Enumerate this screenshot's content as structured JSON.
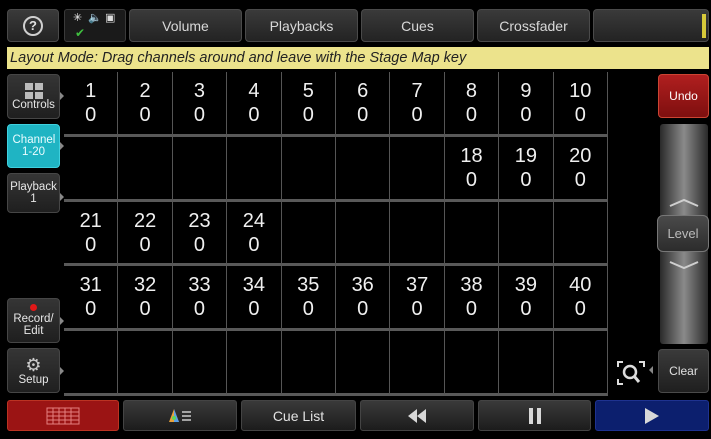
{
  "toolbar": {
    "help_icon": "?",
    "status_icons": [
      "sun-icon",
      "speaker-icon",
      "image-icon",
      "check-icon"
    ],
    "buttons": [
      "Volume",
      "Playbacks",
      "Cues",
      "Crossfader"
    ]
  },
  "banner": "Layout Mode: Drag channels around and leave with the Stage Map key",
  "sidebar": {
    "controls": "Controls",
    "channel": "Channel 1-20",
    "playback": "Playback 1",
    "record_edit": "Record/ Edit",
    "setup": "Setup"
  },
  "grid": {
    "rows": [
      [
        {
          "num": "1",
          "val": "0"
        },
        {
          "num": "2",
          "val": "0"
        },
        {
          "num": "3",
          "val": "0"
        },
        {
          "num": "4",
          "val": "0"
        },
        {
          "num": "5",
          "val": "0"
        },
        {
          "num": "6",
          "val": "0"
        },
        {
          "num": "7",
          "val": "0"
        },
        {
          "num": "8",
          "val": "0"
        },
        {
          "num": "9",
          "val": "0"
        },
        {
          "num": "10",
          "val": "0"
        }
      ],
      [
        {
          "num": "",
          "val": ""
        },
        {
          "num": "",
          "val": ""
        },
        {
          "num": "",
          "val": ""
        },
        {
          "num": "",
          "val": ""
        },
        {
          "num": "",
          "val": ""
        },
        {
          "num": "",
          "val": ""
        },
        {
          "num": "",
          "val": ""
        },
        {
          "num": "18",
          "val": "0"
        },
        {
          "num": "19",
          "val": "0"
        },
        {
          "num": "20",
          "val": "0"
        }
      ],
      [
        {
          "num": "21",
          "val": "0"
        },
        {
          "num": "22",
          "val": "0"
        },
        {
          "num": "23",
          "val": "0"
        },
        {
          "num": "24",
          "val": "0"
        },
        {
          "num": "",
          "val": ""
        },
        {
          "num": "",
          "val": ""
        },
        {
          "num": "",
          "val": ""
        },
        {
          "num": "",
          "val": ""
        },
        {
          "num": "",
          "val": ""
        },
        {
          "num": "",
          "val": ""
        }
      ],
      [
        {
          "num": "31",
          "val": "0"
        },
        {
          "num": "32",
          "val": "0"
        },
        {
          "num": "33",
          "val": "0"
        },
        {
          "num": "34",
          "val": "0"
        },
        {
          "num": "35",
          "val": "0"
        },
        {
          "num": "36",
          "val": "0"
        },
        {
          "num": "37",
          "val": "0"
        },
        {
          "num": "38",
          "val": "0"
        },
        {
          "num": "39",
          "val": "0"
        },
        {
          "num": "40",
          "val": "0"
        }
      ],
      [
        {
          "num": "",
          "val": ""
        },
        {
          "num": "",
          "val": ""
        },
        {
          "num": "",
          "val": ""
        },
        {
          "num": "",
          "val": ""
        },
        {
          "num": "",
          "val": ""
        },
        {
          "num": "",
          "val": ""
        },
        {
          "num": "",
          "val": ""
        },
        {
          "num": "",
          "val": ""
        },
        {
          "num": "",
          "val": ""
        },
        {
          "num": "",
          "val": ""
        }
      ]
    ]
  },
  "right": {
    "undo": "Undo",
    "level": "Level",
    "clear": "Clear"
  },
  "bottom": {
    "cue_list": "Cue List",
    "icons": [
      "grid-icon",
      "color-fx-icon",
      "rewind-icon",
      "pause-icon",
      "play-icon"
    ]
  },
  "colors": {
    "banner_bg": "#ece38c",
    "active_tab": "#1fb4c3",
    "undo_red": "#9b1414",
    "play_blue": "#0c1f6e"
  }
}
